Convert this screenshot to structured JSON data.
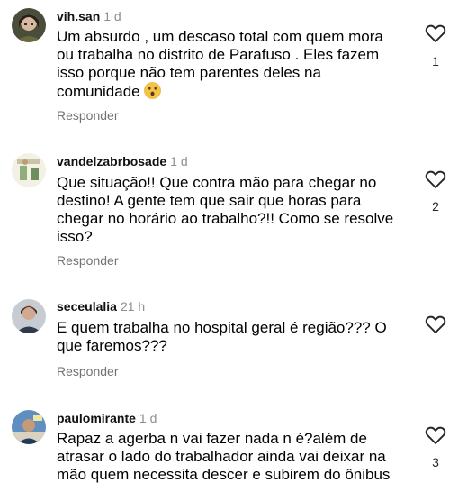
{
  "reply_label": "Responder",
  "comments": [
    {
      "username": "vih.san",
      "time": "1 d",
      "lines": [
        "Um absurdo , um descaso total com quem mora",
        "ou trabalha no distrito de Parafuso . Eles fazem",
        "isso porque não tem parentes deles  na",
        "comunidade"
      ],
      "emoji": "astonished-face",
      "likes": "1"
    },
    {
      "username": "vandelzabrbosade",
      "time": "1 d",
      "lines": [
        "Que situação!! Que contra mão para chegar no",
        "destino! A gente tem que sair que horas para",
        "chegar no horário ao trabalho?!! Como se resolve",
        "isso?"
      ],
      "likes": "2"
    },
    {
      "username": "seceulalia",
      "time": "21 h",
      "lines": [
        "E quem trabalha no hospital geral é região??? O",
        "que faremos???"
      ],
      "likes": ""
    },
    {
      "username": "paulomirante",
      "time": "1 d",
      "lines": [
        "Rapaz a agerba n vai fazer nada n é?além de",
        "atrasar o lado do trabalhador ainda vai deixar na",
        "mão quem necessita descer e subirem do ônibus"
      ],
      "likes": "3"
    }
  ],
  "colors": {
    "muted": "#8e8e8e",
    "reply": "#737373",
    "text": "#000000"
  }
}
